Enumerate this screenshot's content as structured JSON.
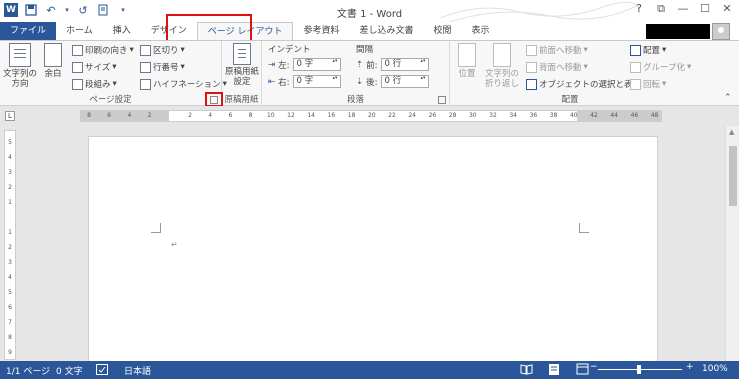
{
  "title": "文書 1 - Word",
  "qat": {
    "save_icon": "save-icon",
    "undo_icon": "undo-icon",
    "redo_icon": "redo-icon"
  },
  "window_controls": [
    "?",
    "⧉",
    "—",
    "☐",
    "✕"
  ],
  "tabs": [
    {
      "label": "ファイル"
    },
    {
      "label": "ホーム"
    },
    {
      "label": "挿入"
    },
    {
      "label": "デザイン"
    },
    {
      "label": "ページ レイアウト"
    },
    {
      "label": "参考資料"
    },
    {
      "label": "差し込み文書"
    },
    {
      "label": "校閲"
    },
    {
      "label": "表示"
    }
  ],
  "ribbon": {
    "page_setup": {
      "label": "ページ設定",
      "text_direction": "文字列の\n方向",
      "margins": "余白",
      "orientation": "印刷の向き",
      "size": "サイズ",
      "columns": "段組み",
      "breaks": "区切り",
      "line_numbers": "行番号",
      "hyphenation": "ハイフネーション"
    },
    "genko": {
      "label": "原稿用紙",
      "button": "原稿用紙\n設定"
    },
    "paragraph": {
      "label": "段落",
      "indent_header": "インデント",
      "spacing_header": "間隔",
      "left_label": "左:",
      "left_value": "0 字",
      "right_label": "右:",
      "right_value": "0 字",
      "before_label": "前:",
      "before_value": "0 行",
      "after_label": "後:",
      "after_value": "0 行"
    },
    "arrange": {
      "label": "配置",
      "position": "位置",
      "wrap_text": "文字列の\n折り返し",
      "bring_forward": "前面へ移動",
      "send_backward": "背面へ移動",
      "selection_pane": "オブジェクトの選択と表示",
      "align": "配置",
      "group": "グループ化",
      "rotate": "回転"
    }
  },
  "ruler_numbers": [
    "8",
    "6",
    "4",
    "2",
    "",
    "2",
    "4",
    "6",
    "8",
    "10",
    "12",
    "14",
    "16",
    "18",
    "20",
    "22",
    "24",
    "26",
    "28",
    "30",
    "32",
    "34",
    "36",
    "38",
    "40",
    "42",
    "44",
    "46",
    "48"
  ],
  "vruler_numbers": [
    "5",
    "4",
    "3",
    "2",
    "1",
    "",
    "1",
    "2",
    "3",
    "4",
    "5",
    "6",
    "7",
    "8",
    "9"
  ],
  "document": {
    "paragraph_mark": "↵"
  },
  "status": {
    "page": "1/1 ページ",
    "words": "0 文字",
    "language": "日本語",
    "zoom": "100%",
    "zoom_minus": "−",
    "zoom_plus": "+"
  },
  "colors": {
    "accent": "#2b579a",
    "highlight": "#dd1111"
  }
}
